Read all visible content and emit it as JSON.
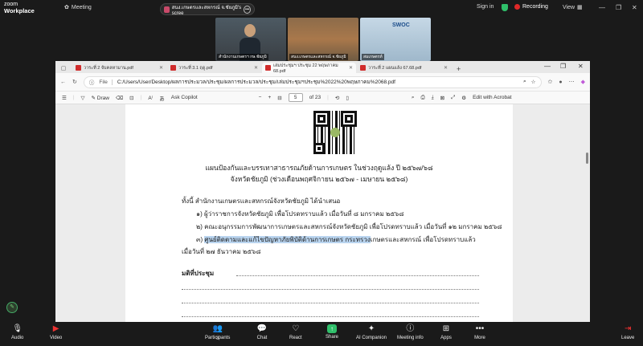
{
  "zoom": {
    "brand_line1": "zoom",
    "brand_line2": "Workplace",
    "meeting_label": "Meeting",
    "share_label": "สนง.เกษตรและสหกรณ์ จ.ชัยภูมิ's scree",
    "sign_in": "Sign in",
    "recording": "Recording",
    "view": "View"
  },
  "participants_tiles": [
    {
      "name": "สำนักงานเกษตรฯ กษ.ชัยภูมิ"
    },
    {
      "name": "สนง.เกษตรและสหกรณ์ จ.ชัยภูมิ"
    },
    {
      "name": "สมเกษตรท์"
    }
  ],
  "browser": {
    "tabs": [
      {
        "label": "วาระที่ 2 จับคลหามาน.pdf",
        "active": false
      },
      {
        "label": "วาระที่ 3.1 ฤดู.pdf",
        "active": false
      },
      {
        "label": "เล่มประชุมฯ ประชุม 22 พฤษภาคม 68.pdf",
        "active": true
      },
      {
        "label": "วาระที่ 2 แผนแล้ง 67.68.pdf",
        "active": false
      }
    ],
    "address": "C:/Users/User/Desktop/ผลการประมวล/ประชุม/ผลการประมวล/ประชุม/เล่มประชุมฯประชุม%2022%20พฤษภาคม%2068.pdf",
    "file_label": "File",
    "pdf_toolbar": {
      "draw": "Draw",
      "ask_copilot": "Ask Copilot",
      "zoom_minus": "−",
      "zoom_plus": "+",
      "page_current": "5",
      "page_total": "of 23",
      "edit_acrobat": "Edit with Acrobat"
    }
  },
  "document": {
    "title_line1": "แผนป้องกันและบรรเทาสาธารณภัยด้านการเกษตร ในช่วงฤดูแล้ง ปี ๒๕๖๗/๖๘",
    "title_line2": "จังหวัดชัยภูมิ (ช่วงเดือนพฤศจิกายน ๒๕๖๗ - เมษายน ๒๕๖๘)",
    "intro": "ทั้งนี้ สำนักงานเกษตรและสหกรณ์จังหวัดชัยภูมิ ได้นำเสนอ",
    "item1": "๑) ผู้ว่าราชการจังหวัดชัยภูมิ เพื่อโปรดทราบแล้ว เมื่อวันที่ ๘ มกราคม ๒๕๖๘",
    "item2": "๒) คณะอนุกรรมการพัฒนาการเกษตรและสหกรณ์จังหวัดชัยภูมิ เพื่อโปรดทราบแล้ว เมื่อวันที่ ๑๒ มกราคม ๒๕๖๘",
    "item3_prefix": "๓) ",
    "item3_highlight": "ศูนย์ติดตามและแก้ไขปัญหาภัยพิบัติด้านการเกษตร กระทรวง",
    "item3_suffix": "เกษตรและสหกรณ์ เพื่อโปรดทราบแล้ว",
    "item3_cont": "เมื่อวันที่ ๒๗ ธันวาคม ๒๕๖๘",
    "resolution_label": "มติที่ประชุม"
  },
  "toolbar": {
    "audio": "Audio",
    "video": "Video",
    "participants": "Participants",
    "participants_count": "3",
    "chat": "Chat",
    "react": "React",
    "share": "Share",
    "ai_companion": "AI Companion",
    "meeting_info": "Meeting info",
    "apps": "Apps",
    "more": "More",
    "leave": "Leave"
  }
}
